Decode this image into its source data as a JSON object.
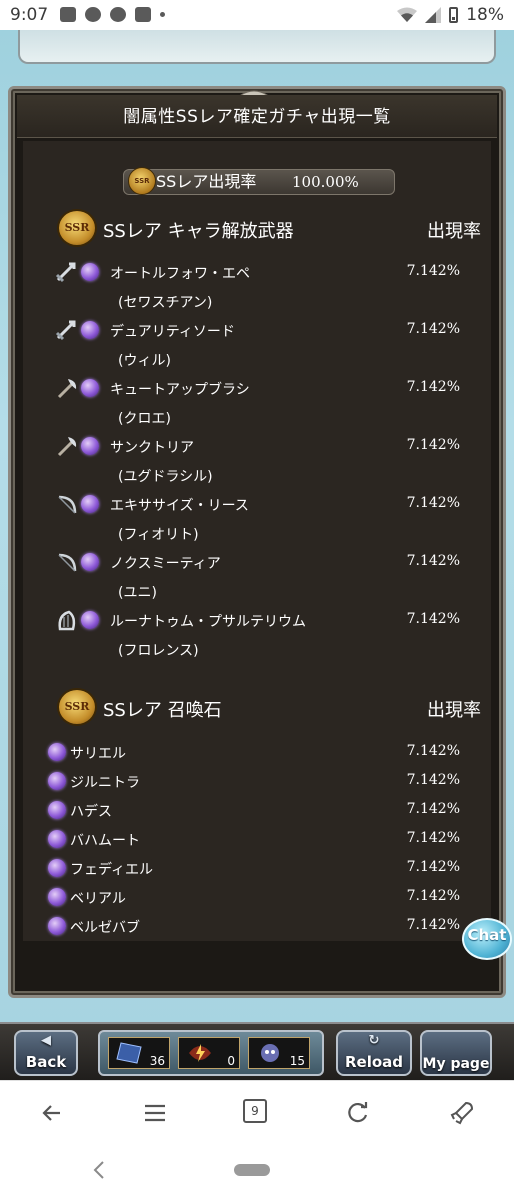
{
  "status_bar": {
    "time": "9:07",
    "battery": "18%"
  },
  "panel": {
    "title": "闇属性SSレア確定ガチャ出現一覧",
    "rate_label": "SSレア出現率",
    "rate_value": "100.00%"
  },
  "sections": {
    "weapons": {
      "title": "SSレア キャラ解放武器",
      "rate_header": "出現率",
      "items": [
        {
          "name": "オートルフォワ・エペ",
          "character": "(セワスチアン)",
          "rate": "7.142%",
          "icon": "sword-icon"
        },
        {
          "name": "デュアリティソード",
          "character": "(ウィル)",
          "rate": "7.142%",
          "icon": "sword-icon"
        },
        {
          "name": "キュートアップブラシ",
          "character": "(クロエ)",
          "rate": "7.142%",
          "icon": "axe-icon"
        },
        {
          "name": "サンクトリア",
          "character": "(ユグドラシル)",
          "rate": "7.142%",
          "icon": "axe-icon"
        },
        {
          "name": "エキササイズ・リース",
          "character": "(フィオリト)",
          "rate": "7.142%",
          "icon": "bow-icon"
        },
        {
          "name": "ノクスミーティア",
          "character": "(ユニ)",
          "rate": "7.142%",
          "icon": "bow-icon"
        },
        {
          "name": "ルーナトゥム・プサルテリウム",
          "character": "(フロレンス)",
          "rate": "7.142%",
          "icon": "harp-icon"
        }
      ]
    },
    "summons": {
      "title": "SSレア 召喚石",
      "rate_header": "出現率",
      "items": [
        {
          "name": "サリエル",
          "rate": "7.142%"
        },
        {
          "name": "ジルニトラ",
          "rate": "7.142%"
        },
        {
          "name": "ハデス",
          "rate": "7.142%"
        },
        {
          "name": "バハムート",
          "rate": "7.142%"
        },
        {
          "name": "フェディエル",
          "rate": "7.142%"
        },
        {
          "name": "ベリアル",
          "rate": "7.142%"
        },
        {
          "name": "ベルゼバブ",
          "rate": "7.142%"
        }
      ]
    }
  },
  "chat_button": "Chat",
  "footer": {
    "back": "Back",
    "reload": "Reload",
    "mypage": "My page",
    "item_counts": [
      "36",
      "0",
      "15"
    ]
  },
  "browser": {
    "tab_count": "9"
  },
  "colors": {
    "panel_bg": "#2b2621",
    "orb": "#8e5ad8",
    "sky": "#a7d4e1"
  }
}
